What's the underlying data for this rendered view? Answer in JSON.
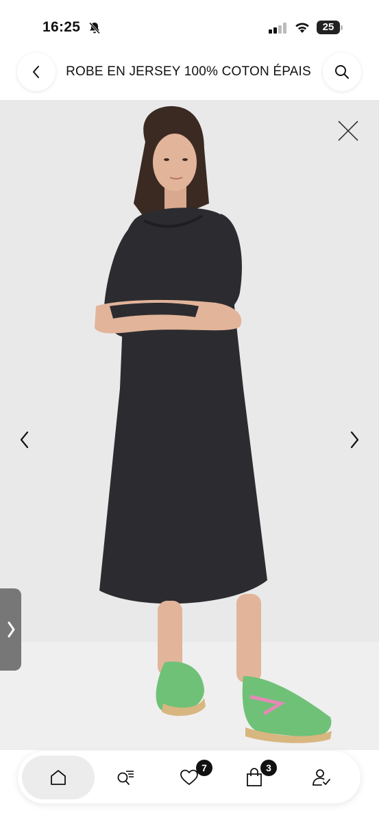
{
  "status_bar": {
    "time": "16:25",
    "battery": "25"
  },
  "header": {
    "title": "ROBE EN JERSEY 100% COTON ÉPAIS"
  },
  "nav": {
    "favorites_count": "7",
    "cart_count": "3"
  },
  "icons": [
    "bell-slash-icon",
    "signal-icon",
    "wifi-icon",
    "battery-icon",
    "back-icon",
    "search-icon",
    "close-icon",
    "chevron-left-icon",
    "chevron-right-icon",
    "side-tab-chevron-icon",
    "home-icon",
    "search-list-icon",
    "heart-icon",
    "bag-icon",
    "account-icon"
  ]
}
